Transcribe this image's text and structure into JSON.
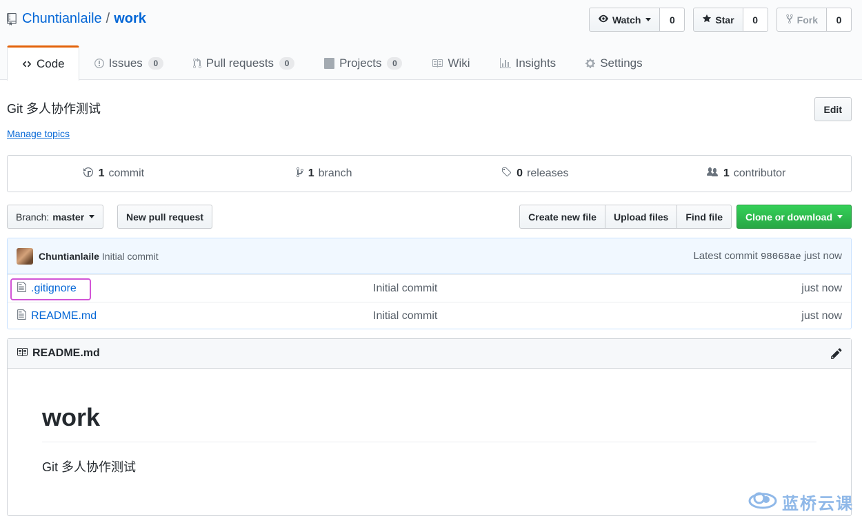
{
  "header": {
    "owner": "Chuntianlaile",
    "separator": "/",
    "repo": "work",
    "watch_label": "Watch",
    "watch_count": "0",
    "star_label": "Star",
    "star_count": "0",
    "fork_label": "Fork",
    "fork_count": "0"
  },
  "nav": {
    "tabs": [
      {
        "label": "Code",
        "icon": "code-icon"
      },
      {
        "label": "Issues",
        "icon": "issue-icon",
        "count": "0"
      },
      {
        "label": "Pull requests",
        "icon": "pull-request-icon",
        "count": "0"
      },
      {
        "label": "Projects",
        "icon": "project-icon",
        "count": "0"
      },
      {
        "label": "Wiki",
        "icon": "book-icon"
      },
      {
        "label": "Insights",
        "icon": "graph-icon"
      },
      {
        "label": "Settings",
        "icon": "gear-icon"
      }
    ],
    "selected": "Code"
  },
  "meta": {
    "description": "Git 多人协作测试",
    "manage_topics": "Manage topics",
    "edit_label": "Edit"
  },
  "summary": {
    "commits_num": "1",
    "commits_label": "commit",
    "branches_num": "1",
    "branches_label": "branch",
    "releases_num": "0",
    "releases_label": "releases",
    "contributors_num": "1",
    "contributors_label": "contributor"
  },
  "file_nav": {
    "branch_prefix": "Branch:",
    "branch_name": "master",
    "new_pr": "New pull request",
    "create_file": "Create new file",
    "upload_files": "Upload files",
    "find_file": "Find file",
    "clone": "Clone or download"
  },
  "commit": {
    "author": "Chuntianlaile",
    "message": "Initial commit",
    "latest_label": "Latest commit",
    "sha": "98068ae",
    "age": "just now"
  },
  "files": [
    {
      "name": ".gitignore",
      "message": "Initial commit",
      "age": "just now"
    },
    {
      "name": "README.md",
      "message": "Initial commit",
      "age": "just now"
    }
  ],
  "readme": {
    "filename": "README.md",
    "heading": "work",
    "body": "Git 多人协作测试"
  },
  "watermark": "蓝桥云课",
  "colors": {
    "link": "#0366d6",
    "selected_tab_border": "#e36209",
    "primary_button": "#28a745",
    "highlight_box": "#d255d6"
  }
}
